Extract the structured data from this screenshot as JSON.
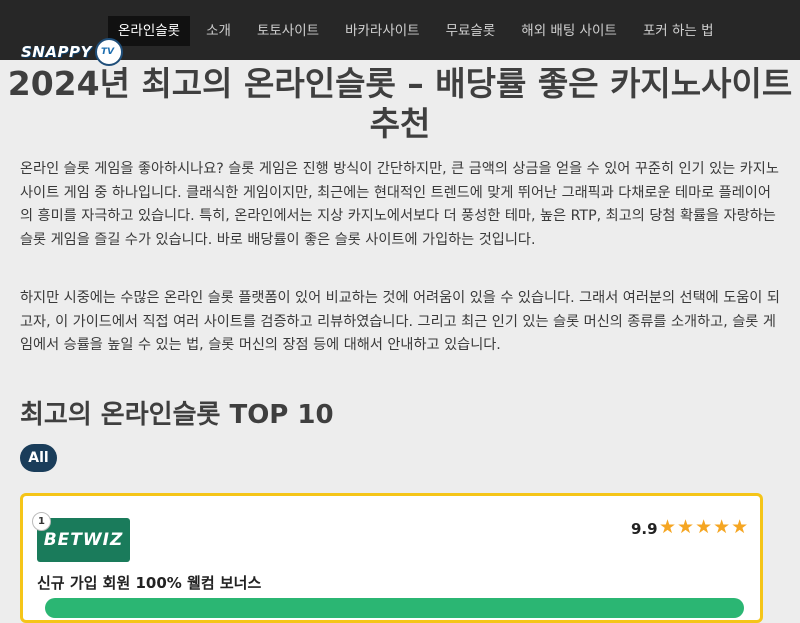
{
  "nav": {
    "items": [
      "온라인슬롯",
      "소개",
      "토토사이트",
      "바카라사이트",
      "무료슬롯",
      "해외 배팅 사이트",
      "포커 하는 법"
    ],
    "active_index": 0
  },
  "logo": {
    "text": "SNAPPY",
    "badge": "TV"
  },
  "page": {
    "title": "2024년 최고의 온라인슬롯 – 배당률 좋은 카지노사이트 추천",
    "intro_1": "온라인 슬롯 게임을 좋아하시나요? 슬롯 게임은 진행 방식이 간단하지만, 큰 금액의 상금을 얻을 수 있어 꾸준히 인기 있는 카지노사이트 게임 중 하나입니다. 클래식한 게임이지만, 최근에는 현대적인 트렌드에 맞게 뛰어난 그래픽과 다채로운 테마로 플레이어의 흥미를 자극하고 있습니다. 특히, 온라인에서는 지상 카지노에서보다 더 풍성한 테마, 높은 RTP, 최고의 당첨 확률을 자랑하는 슬롯 게임을 즐길 수가 있습니다. 바로 배당률이 좋은 슬롯 사이트에 가입하는 것입니다.",
    "intro_2": "하지만 시중에는 수많은 온라인 슬롯 플랫폼이 있어 비교하는 것에 어려움이 있을 수 있습니다. 그래서 여러분의 선택에 도움이 되고자, 이 가이드에서 직접 여러 사이트를 검증하고 리뷰하였습니다. 그리고 최근 인기 있는 슬롯 머신의 종류를 소개하고, 슬롯 게임에서 승률을 높일 수 있는 법, 슬롯 머신의 장점 등에 대해서 안내하고 있습니다.",
    "section_title": "최고의 온라인슬롯 TOP 10",
    "filter_label": "All"
  },
  "card": {
    "rank": "1",
    "brand": "BETWIZ",
    "score": "9.9",
    "stars": "★★★★★",
    "bonus": "신규 가입 회원 100% 웰컴 보너스"
  },
  "colors": {
    "topbar": "#272727",
    "card_border": "#f5c518",
    "star": "#f5a623",
    "brand_bg": "#1a7b5b",
    "filter_bg": "#1a3d5a",
    "cta": "#2bb673"
  }
}
